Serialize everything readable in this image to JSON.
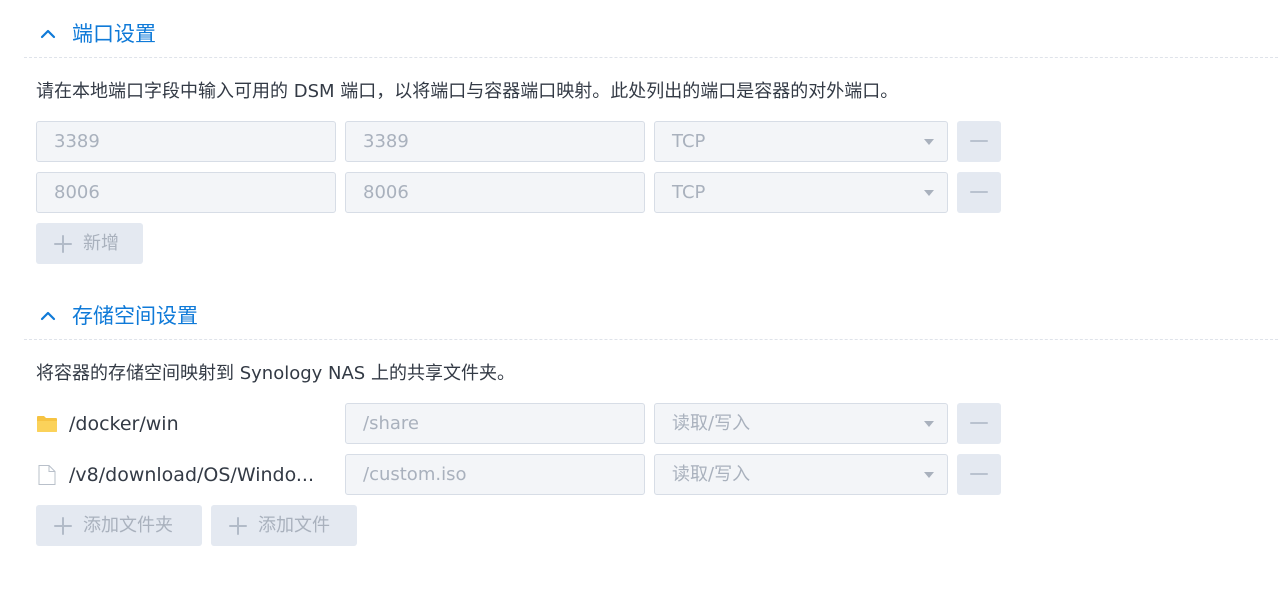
{
  "ports": {
    "title": "端口设置",
    "description": "请在本地端口字段中输入可用的 DSM 端口，以将端口与容器端口映射。此处列出的端口是容器的对外端口。",
    "rows": [
      {
        "local": "3389",
        "container": "3389",
        "protocol": "TCP"
      },
      {
        "local": "8006",
        "container": "8006",
        "protocol": "TCP"
      }
    ],
    "add_label": "新增"
  },
  "storage": {
    "title": "存储空间设置",
    "description": "将容器的存储空间映射到 Synology NAS 上的共享文件夹。",
    "rows": [
      {
        "type": "folder",
        "source": "/docker/win",
        "mount": "/share",
        "mode": "读取/写入"
      },
      {
        "type": "file",
        "source": "/v8/download/OS/Windo...",
        "mount": "/custom.iso",
        "mode": "读取/写入"
      }
    ],
    "add_folder_label": "添加文件夹",
    "add_file_label": "添加文件"
  },
  "colors": {
    "accent": "#0f7ad8",
    "folder": "#f6c342",
    "disabled_text": "#a9b1bd",
    "field_bg": "#f3f5f8"
  },
  "icons": {
    "collapse": "chevron-up-icon",
    "remove": "minus-icon",
    "add": "plus-icon",
    "folder": "folder-icon",
    "file": "file-icon",
    "dropdown": "caret-down-icon"
  }
}
